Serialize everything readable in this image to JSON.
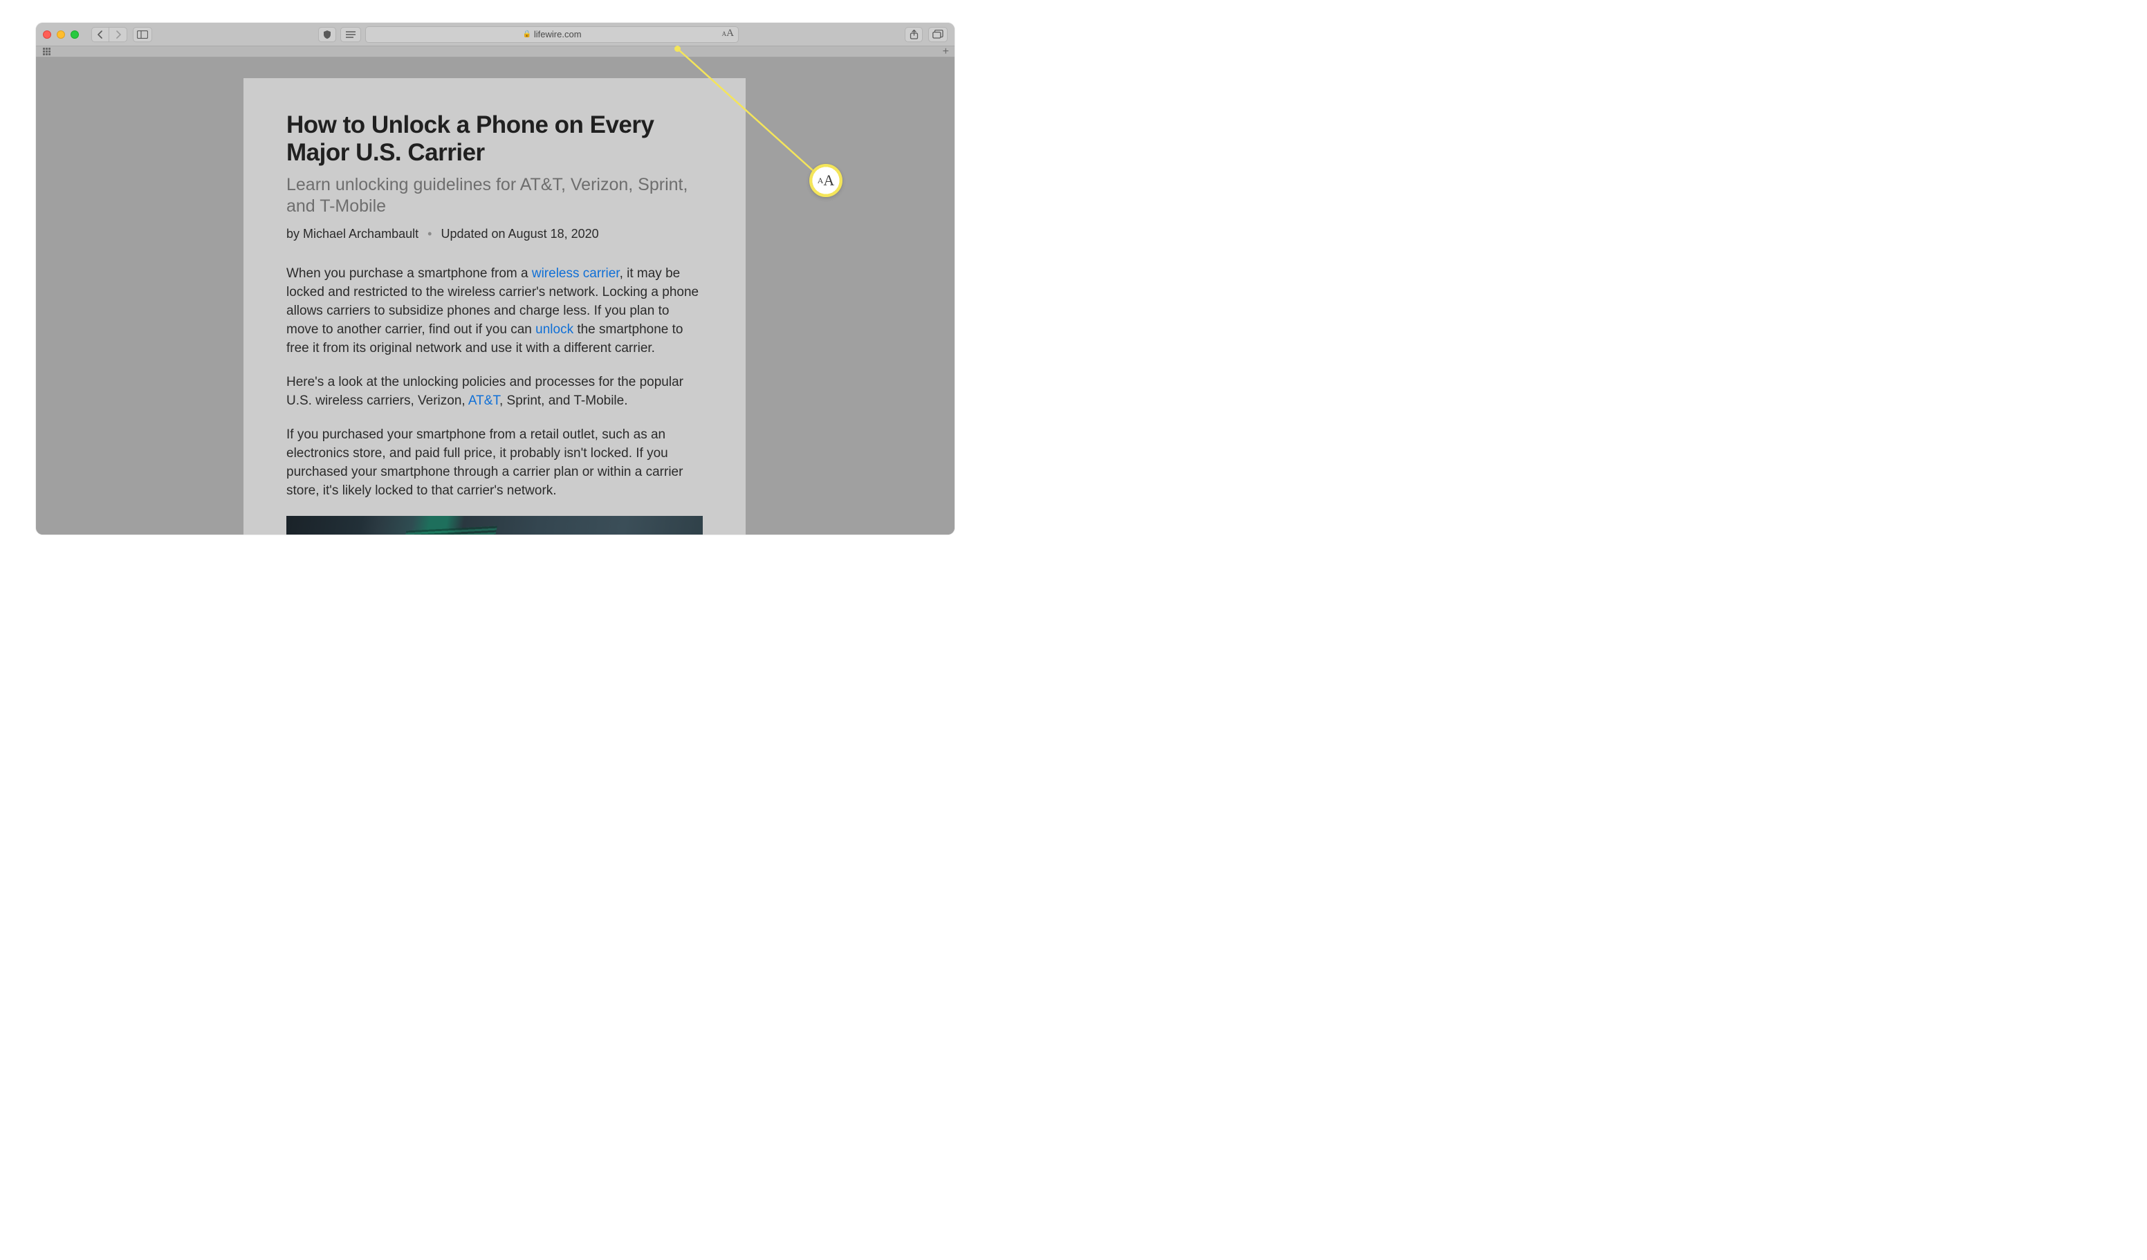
{
  "browser": {
    "domain": "lifewire.com",
    "text_size_label_small": "A",
    "text_size_label_big": "A"
  },
  "callout": {
    "small": "A",
    "big": "A"
  },
  "article": {
    "title": "How to Unlock a Phone on Every Major U.S. Carrier",
    "subtitle": "Learn unlocking guidelines for AT&T, Verizon, Sprint, and T-Mobile",
    "byline_prefix": "by ",
    "author": "Michael Archambault",
    "updated_prefix": "Updated on ",
    "updated_date": "August 18, 2020",
    "p1_a": "When you purchase a smartphone from a ",
    "p1_link1": "wireless carrier",
    "p1_b": ", it may be locked and restricted to the wireless carrier's network. Locking a phone allows carriers to subsidize phones and charge less. If you plan to move to another carrier, find out if you can ",
    "p1_link2": "unlock",
    "p1_c": " the smartphone to free it from its original network and use it with a different carrier.",
    "p2_a": "Here's a look at the unlocking policies and processes for the popular U.S. wireless carriers, Verizon, ",
    "p2_link1": "AT&T",
    "p2_b": ", Sprint, and T-Mobile.",
    "p3": "If you purchased your smartphone from a retail outlet, such as an electronics store, and paid full price, it probably isn't locked. If you purchased your smartphone through a carrier plan or within a carrier store, it's likely locked to that carrier's network."
  }
}
